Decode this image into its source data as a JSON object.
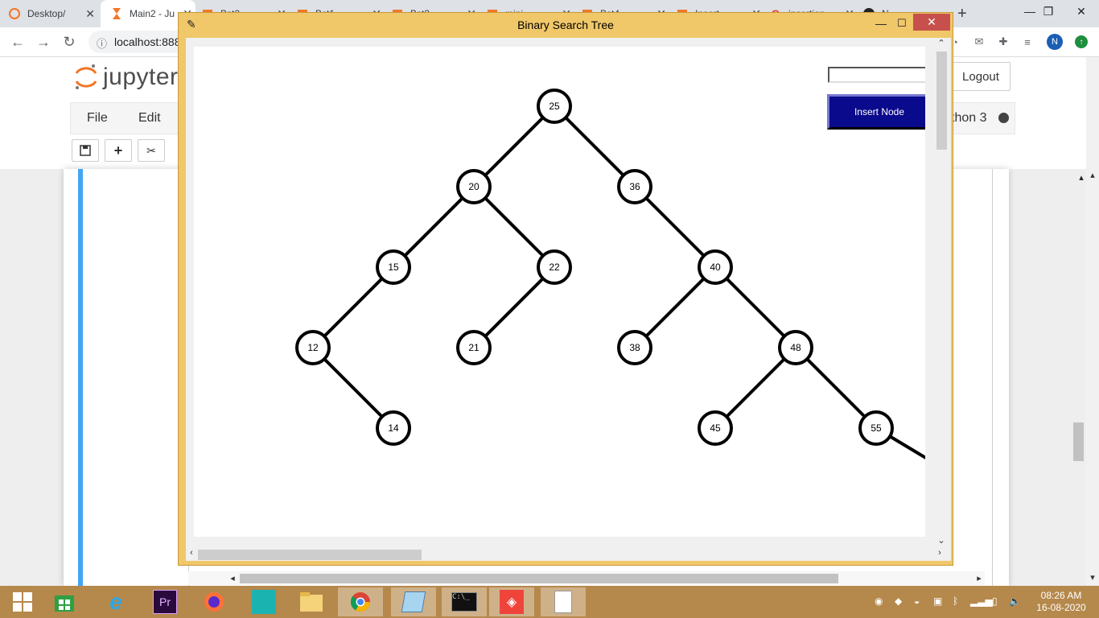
{
  "browser": {
    "tabs": [
      {
        "label": "Desktop/",
        "icon": "jupyter-icon"
      },
      {
        "label": "Main2 - Ju",
        "icon": "hourglass-icon"
      },
      {
        "label": "Bst2",
        "icon": "jupyter-folder-icon"
      },
      {
        "label": "Bst1",
        "icon": "jupyter-folder-icon"
      },
      {
        "label": "Bst3",
        "icon": "jupyter-folder-icon"
      },
      {
        "label": "mini",
        "icon": "jupyter-folder-icon"
      },
      {
        "label": "Bst4",
        "icon": "jupyter-folder-icon"
      },
      {
        "label": "Insert",
        "icon": "jupyter-folder-icon"
      },
      {
        "label": "insertion",
        "icon": "google-icon"
      },
      {
        "label": "N",
        "icon": "github-icon"
      }
    ],
    "new_tab_label": "+",
    "url": "localhost:888",
    "profile_initial": "N"
  },
  "jupyter": {
    "logo_text": "jupyter",
    "logout_label": "Logout",
    "menu": [
      "File",
      "Edit"
    ],
    "kernel_label": "thon 3"
  },
  "tk_window": {
    "title": "Binary Search Tree",
    "input_value": "",
    "insert_button_label": "Insert Node"
  },
  "tree": {
    "nodes": [
      {
        "id": "n25",
        "value": "25",
        "depth": 0,
        "col": 0
      },
      {
        "id": "n20",
        "value": "20",
        "depth": 1,
        "col": -1
      },
      {
        "id": "n36",
        "value": "36",
        "depth": 1,
        "col": 1
      },
      {
        "id": "n15",
        "value": "15",
        "depth": 2,
        "col": -2
      },
      {
        "id": "n22",
        "value": "22",
        "depth": 2,
        "col": 0
      },
      {
        "id": "n40",
        "value": "40",
        "depth": 2,
        "col": 2
      },
      {
        "id": "n12",
        "value": "12",
        "depth": 3,
        "col": -3
      },
      {
        "id": "n21",
        "value": "21",
        "depth": 3,
        "col": -1
      },
      {
        "id": "n38",
        "value": "38",
        "depth": 3,
        "col": 1
      },
      {
        "id": "n48",
        "value": "48",
        "depth": 3,
        "col": 3
      },
      {
        "id": "n14",
        "value": "14",
        "depth": 4,
        "col": -2
      },
      {
        "id": "n45",
        "value": "45",
        "depth": 4,
        "col": 2
      },
      {
        "id": "n55",
        "value": "55",
        "depth": 4,
        "col": 4
      }
    ],
    "edges": [
      [
        "n25",
        "n20"
      ],
      [
        "n25",
        "n36"
      ],
      [
        "n20",
        "n15"
      ],
      [
        "n20",
        "n22"
      ],
      [
        "n36",
        "n40"
      ],
      [
        "n15",
        "n12"
      ],
      [
        "n22",
        "n21"
      ],
      [
        "n40",
        "n38"
      ],
      [
        "n40",
        "n48"
      ],
      [
        "n12",
        "n14"
      ],
      [
        "n48",
        "n45"
      ],
      [
        "n48",
        "n55"
      ]
    ],
    "offscreen_child_of": "n55"
  },
  "taskbar": {
    "icons": [
      "windows-start-icon",
      "store-icon",
      "internet-explorer-icon",
      "premiere-icon",
      "firefox-icon",
      "maya-icon",
      "file-explorer-icon",
      "chrome-icon",
      "notepad-icon",
      "terminal-icon",
      "anydesk-icon",
      "blank-document-icon"
    ],
    "time": "08:26 AM",
    "date": "16-08-2020"
  }
}
